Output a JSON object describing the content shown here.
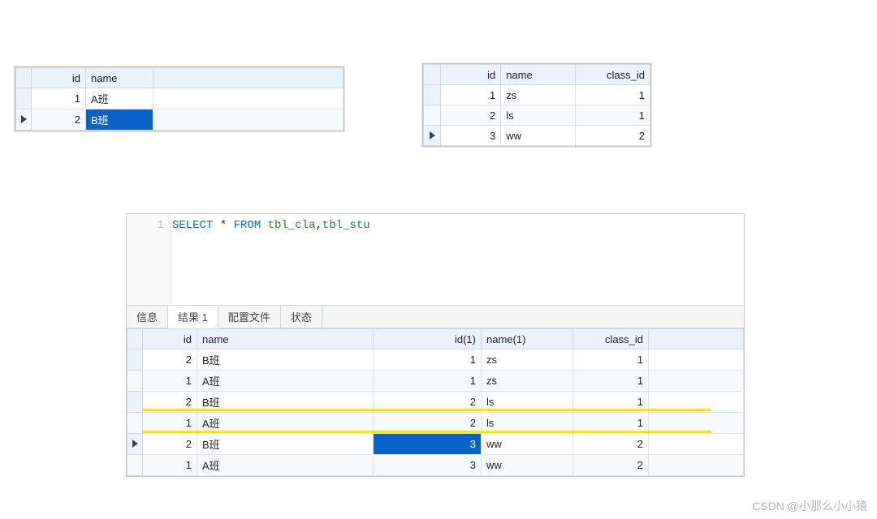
{
  "cla_table": {
    "headers": {
      "id": "id",
      "name": "name"
    },
    "rows": [
      {
        "id": "1",
        "name": "A班",
        "current": false,
        "selected": false
      },
      {
        "id": "2",
        "name": "B班",
        "current": true,
        "selected": true
      }
    ]
  },
  "stu_table": {
    "headers": {
      "id": "id",
      "name": "name",
      "class_id": "class_id"
    },
    "rows": [
      {
        "id": "1",
        "name": "zs",
        "class_id": "1",
        "current": false
      },
      {
        "id": "2",
        "name": "ls",
        "class_id": "1",
        "current": false
      },
      {
        "id": "3",
        "name": "ww",
        "class_id": "2",
        "current": true
      }
    ]
  },
  "editor": {
    "line_no": "1",
    "sql": {
      "kw1": "SELECT",
      "star": "*",
      "kw2": "FROM",
      "id1": "tbl_cla",
      "comma": ",",
      "id2": "tbl_stu"
    },
    "tabs": {
      "info": "信息",
      "result": "结果 1",
      "profile": "配置文件",
      "status": "状态"
    }
  },
  "result_table": {
    "headers": {
      "id": "id",
      "name": "name",
      "id1": "id(1)",
      "name1": "name(1)",
      "class_id": "class_id"
    },
    "rows": [
      {
        "id": "2",
        "name": "B班",
        "id1": "1",
        "name1": "zs",
        "class_id": "1",
        "current": false
      },
      {
        "id": "1",
        "name": "A班",
        "id1": "1",
        "name1": "zs",
        "class_id": "1",
        "current": false
      },
      {
        "id": "2",
        "name": "B班",
        "id1": "2",
        "name1": "ls",
        "class_id": "1",
        "current": false
      },
      {
        "id": "1",
        "name": "A班",
        "id1": "2",
        "name1": "ls",
        "class_id": "1",
        "current": false
      },
      {
        "id": "2",
        "name": "B班",
        "id1": "3",
        "name1": "ww",
        "class_id": "2",
        "current": true
      },
      {
        "id": "1",
        "name": "A班",
        "id1": "3",
        "name1": "ww",
        "class_id": "2",
        "current": false
      }
    ],
    "selected_cell": {
      "row": 4,
      "col": "id1"
    }
  },
  "watermark": "CSDN @小那么小小猿",
  "chart_data": {
    "type": "table",
    "note": "SQL cross-join of two small tables (tbl_cla × tbl_stu) shown in a DB client.",
    "tbl_cla": [
      {
        "id": 1,
        "name": "A班"
      },
      {
        "id": 2,
        "name": "B班"
      }
    ],
    "tbl_stu": [
      {
        "id": 1,
        "name": "zs",
        "class_id": 1
      },
      {
        "id": 2,
        "name": "ls",
        "class_id": 1
      },
      {
        "id": 3,
        "name": "ww",
        "class_id": 2
      }
    ],
    "query": "SELECT * FROM tbl_cla,tbl_stu",
    "result": [
      {
        "id": 2,
        "name": "B班",
        "id(1)": 1,
        "name(1)": "zs",
        "class_id": 1
      },
      {
        "id": 1,
        "name": "A班",
        "id(1)": 1,
        "name(1)": "zs",
        "class_id": 1
      },
      {
        "id": 2,
        "name": "B班",
        "id(1)": 2,
        "name(1)": "ls",
        "class_id": 1
      },
      {
        "id": 1,
        "name": "A班",
        "id(1)": 2,
        "name(1)": "ls",
        "class_id": 1
      },
      {
        "id": 2,
        "name": "B班",
        "id(1)": 3,
        "name(1)": "ww",
        "class_id": 2
      },
      {
        "id": 1,
        "name": "A班",
        "id(1)": 3,
        "name(1)": "ww",
        "class_id": 2
      }
    ]
  }
}
